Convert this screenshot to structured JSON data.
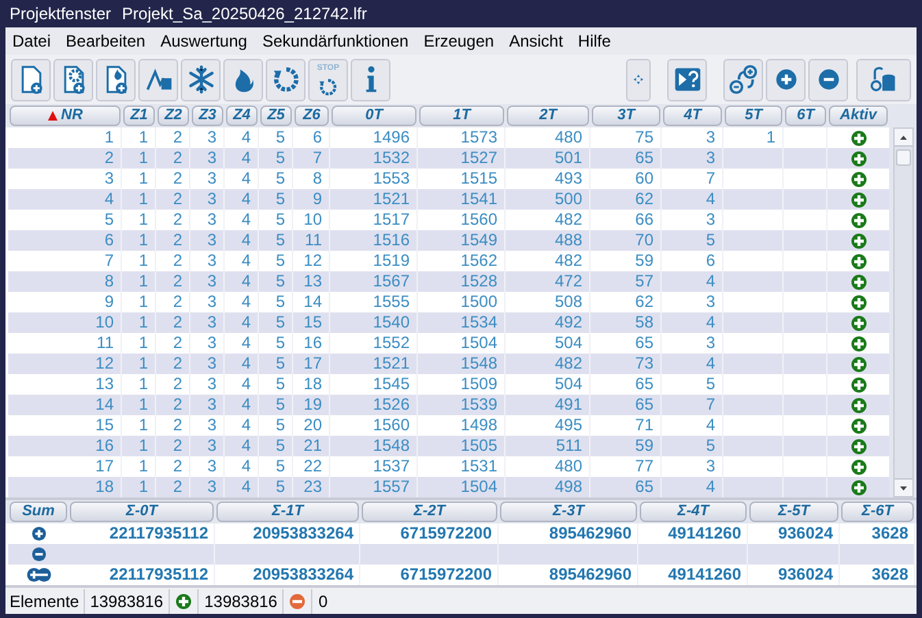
{
  "window": {
    "title": "Projektfenster",
    "subtitle": "Projekt_Sa_20250426_212742.lfr"
  },
  "menu": [
    "Datei",
    "Bearbeiten",
    "Auswertung",
    "Sekundärfunktionen",
    "Erzeugen",
    "Ansicht",
    "Hilfe"
  ],
  "toolbar": {
    "left": [
      {
        "kind": "new"
      },
      {
        "kind": "settings"
      },
      {
        "kind": "ignite"
      },
      {
        "kind": "chart"
      },
      {
        "kind": "cool"
      },
      {
        "kind": "heat"
      },
      {
        "kind": "cycle"
      },
      {
        "kind": "stop",
        "label": "STOP"
      },
      {
        "kind": "info"
      }
    ],
    "right": [
      {
        "kind": "move"
      },
      {
        "kind": "help"
      },
      {
        "kind": "swap"
      },
      {
        "kind": "add"
      },
      {
        "kind": "remove"
      },
      {
        "kind": "store"
      }
    ]
  },
  "table": {
    "columns": [
      {
        "label": "NR",
        "sorted": true
      },
      {
        "label": "Z1",
        "sorted": false
      },
      {
        "label": "Z2",
        "sorted": false
      },
      {
        "label": "Z3",
        "sorted": false
      },
      {
        "label": "Z4",
        "sorted": false
      },
      {
        "label": "Z5",
        "sorted": false
      },
      {
        "label": "Z6",
        "sorted": false
      },
      {
        "label": "0T",
        "sorted": false
      },
      {
        "label": "1T",
        "sorted": false
      },
      {
        "label": "2T",
        "sorted": false
      },
      {
        "label": "3T",
        "sorted": false
      },
      {
        "label": "4T",
        "sorted": false
      },
      {
        "label": "5T",
        "sorted": false
      },
      {
        "label": "6T",
        "sorted": false
      },
      {
        "label": "Aktiv",
        "sorted": false
      }
    ],
    "rows": [
      {
        "cells": [
          "1",
          "1",
          "2",
          "3",
          "4",
          "5",
          "6",
          "1496",
          "1573",
          "480",
          "75",
          "3",
          "1"
        ],
        "active": true
      },
      {
        "cells": [
          "2",
          "1",
          "2",
          "3",
          "4",
          "5",
          "7",
          "1532",
          "1527",
          "501",
          "65",
          "3"
        ],
        "active": true
      },
      {
        "cells": [
          "3",
          "1",
          "2",
          "3",
          "4",
          "5",
          "8",
          "1553",
          "1515",
          "493",
          "60",
          "7"
        ],
        "active": true
      },
      {
        "cells": [
          "4",
          "1",
          "2",
          "3",
          "4",
          "5",
          "9",
          "1521",
          "1541",
          "500",
          "62",
          "4"
        ],
        "active": true
      },
      {
        "cells": [
          "5",
          "1",
          "2",
          "3",
          "4",
          "5",
          "10",
          "1517",
          "1560",
          "482",
          "66",
          "3"
        ],
        "active": true
      },
      {
        "cells": [
          "6",
          "1",
          "2",
          "3",
          "4",
          "5",
          "11",
          "1516",
          "1549",
          "488",
          "70",
          "5"
        ],
        "active": true
      },
      {
        "cells": [
          "7",
          "1",
          "2",
          "3",
          "4",
          "5",
          "12",
          "1519",
          "1562",
          "482",
          "59",
          "6"
        ],
        "active": true
      },
      {
        "cells": [
          "8",
          "1",
          "2",
          "3",
          "4",
          "5",
          "13",
          "1567",
          "1528",
          "472",
          "57",
          "4"
        ],
        "active": true
      },
      {
        "cells": [
          "9",
          "1",
          "2",
          "3",
          "4",
          "5",
          "14",
          "1555",
          "1500",
          "508",
          "62",
          "3"
        ],
        "active": true
      },
      {
        "cells": [
          "10",
          "1",
          "2",
          "3",
          "4",
          "5",
          "15",
          "1540",
          "1534",
          "492",
          "58",
          "4"
        ],
        "active": true
      },
      {
        "cells": [
          "11",
          "1",
          "2",
          "3",
          "4",
          "5",
          "16",
          "1552",
          "1504",
          "504",
          "65",
          "3"
        ],
        "active": true
      },
      {
        "cells": [
          "12",
          "1",
          "2",
          "3",
          "4",
          "5",
          "17",
          "1521",
          "1548",
          "482",
          "73",
          "4"
        ],
        "active": true
      },
      {
        "cells": [
          "13",
          "1",
          "2",
          "3",
          "4",
          "5",
          "18",
          "1545",
          "1509",
          "504",
          "65",
          "5"
        ],
        "active": true
      },
      {
        "cells": [
          "14",
          "1",
          "2",
          "3",
          "4",
          "5",
          "19",
          "1526",
          "1539",
          "491",
          "65",
          "7"
        ],
        "active": true
      },
      {
        "cells": [
          "15",
          "1",
          "2",
          "3",
          "4",
          "5",
          "20",
          "1560",
          "1498",
          "495",
          "71",
          "4"
        ],
        "active": true
      },
      {
        "cells": [
          "16",
          "1",
          "2",
          "3",
          "4",
          "5",
          "21",
          "1548",
          "1505",
          "511",
          "59",
          "5"
        ],
        "active": true
      },
      {
        "cells": [
          "17",
          "1",
          "2",
          "3",
          "4",
          "5",
          "22",
          "1537",
          "1531",
          "480",
          "77",
          "3"
        ],
        "active": true
      },
      {
        "cells": [
          "18",
          "1",
          "2",
          "3",
          "4",
          "5",
          "23",
          "1557",
          "1504",
          "498",
          "65",
          "4"
        ],
        "active": true
      }
    ]
  },
  "sums": {
    "columns": [
      "Sum",
      "Σ-0T",
      "Σ-1T",
      "Σ-2T",
      "Σ-3T",
      "Σ-4T",
      "Σ-5T",
      "Σ-6T"
    ],
    "rows": [
      {
        "kind": "plus",
        "values": [
          "22117935112",
          "20953833264",
          "6715972200",
          "895462960",
          "49141260",
          "936024",
          "3628"
        ]
      },
      {
        "kind": "minus"
      },
      {
        "kind": "both",
        "values": [
          "22117935112",
          "20953833264",
          "6715972200",
          "895462960",
          "49141260",
          "936024",
          "3628"
        ]
      }
    ]
  },
  "status_bar": {
    "label": "Elemente",
    "total": "13983816",
    "active": "13983816",
    "inactive": "0"
  }
}
